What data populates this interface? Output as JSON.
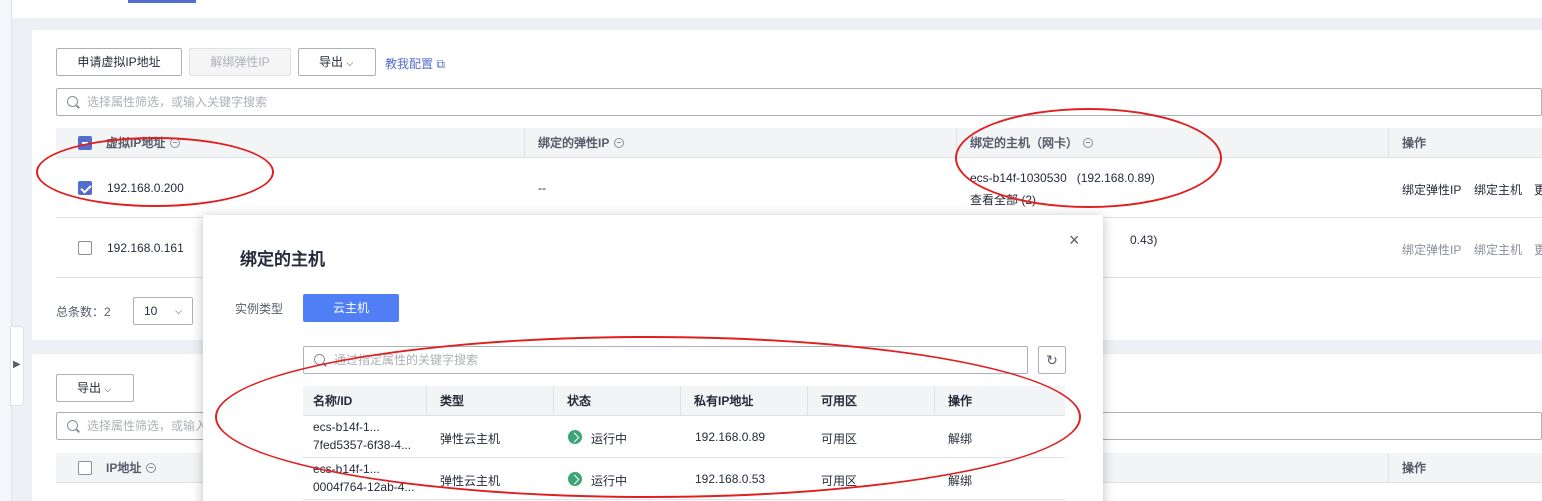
{
  "toolbar": {
    "apply_vip": "申请虚拟IP地址",
    "unbind_eip": "解绑弹性IP",
    "export": "导出",
    "teach": "教我配置"
  },
  "search": {
    "placeholder1": "选择属性筛选，或输入关键字搜索",
    "placeholder2": "选择属性筛选，或输入关"
  },
  "table1": {
    "headers": [
      "虚拟IP地址",
      "绑定的弹性IP",
      "绑定的主机（网卡）",
      "操作"
    ],
    "rows": [
      {
        "ip": "192.168.0.200",
        "eip": "--",
        "host": "ecs-b14f-1030530   (192.168.0.89)",
        "more": "查看全部 (2)",
        "op1": "绑定弹性IP",
        "op2": "绑定主机",
        "op3": "更"
      },
      {
        "ip": "192.168.0.161",
        "host_tail": "0.43)",
        "op1": "绑定弹性IP",
        "op2": "绑定主机",
        "op3": "更"
      }
    ],
    "total_label": "总条数：2",
    "page_size": "10"
  },
  "section2": {
    "export": "导出",
    "header_ip": "IP地址",
    "header_op": "操作"
  },
  "modal": {
    "title": "绑定的主机",
    "instance_type_label": "实例类型",
    "instance_type_value": "云主机",
    "search_placeholder": "通过指定属性的关键字搜索",
    "headers": [
      "名称/ID",
      "类型",
      "状态",
      "私有IP地址",
      "可用区",
      "操作"
    ],
    "rows": [
      {
        "name": "ecs-b14f-1...",
        "id": "7fed5357-6f38-4...",
        "type": "弹性云主机",
        "status": "运行中",
        "ip": "192.168.0.89",
        "az": "可用区",
        "op": "解绑"
      },
      {
        "name": "ecs-b14f-1...",
        "id": "0004f764-12ab-4...",
        "type": "弹性云主机",
        "status": "运行中",
        "ip": "192.168.0.53",
        "az": "可用区",
        "op": "解绑"
      }
    ]
  },
  "colors": {
    "accent": "#526ecc",
    "primary_btn": "#4f7ef5",
    "running": "#3ba675",
    "annotation": "#e02020"
  }
}
